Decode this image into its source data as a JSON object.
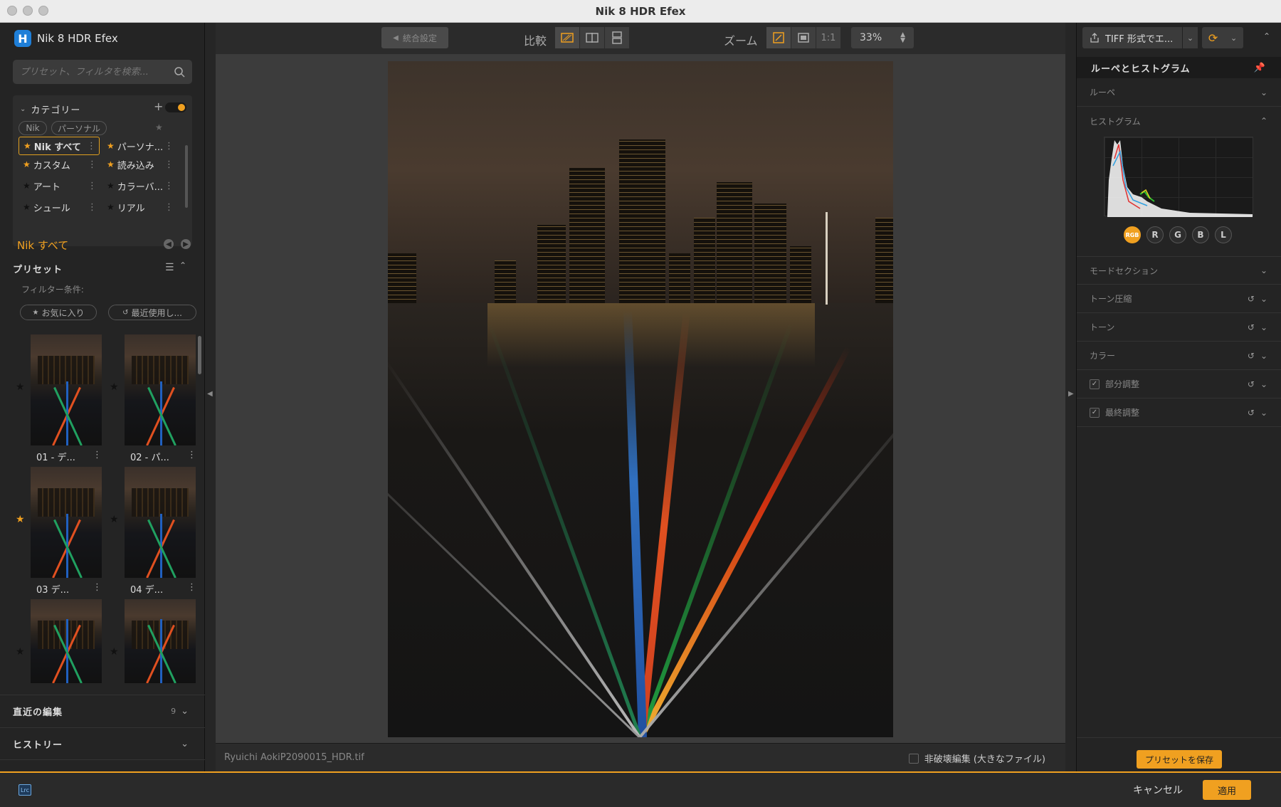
{
  "window": {
    "title": "Nik 8 HDR Efex"
  },
  "brand": {
    "name": "Nik 8 HDR Efex",
    "logo": "H"
  },
  "search": {
    "placeholder": "プリセット、フィルタを検索..."
  },
  "categories": {
    "title": "カテゴリー",
    "pills": [
      "Nik",
      "パーソナル"
    ],
    "items": [
      {
        "label": "Nik すべて",
        "starred": true,
        "selected": true
      },
      {
        "label": "パーソナ...",
        "starred": true,
        "selected": false
      },
      {
        "label": "カスタム",
        "starred": true,
        "selected": false
      },
      {
        "label": "読み込み",
        "starred": true,
        "selected": false
      },
      {
        "label": "アート",
        "starred": false,
        "selected": false
      },
      {
        "label": "カラーバ...",
        "starred": false,
        "selected": false
      },
      {
        "label": "シュール",
        "starred": false,
        "selected": false
      },
      {
        "label": "リアル",
        "starred": false,
        "selected": false
      }
    ]
  },
  "current_category": "Nik すべて",
  "presets": {
    "title": "プリセット",
    "filter_label": "フィルター条件:",
    "filters": [
      "お気に入り",
      "最近使用し..."
    ],
    "thumbs": [
      {
        "label": "01 - デ...",
        "starred": false
      },
      {
        "label": "02 - パ...",
        "starred": false
      },
      {
        "label": "03 デ...",
        "starred": true
      },
      {
        "label": "04 デ...",
        "starred": false
      },
      {
        "label": "",
        "starred": false
      },
      {
        "label": "",
        "starred": false
      }
    ]
  },
  "recent_edits": {
    "title": "直近の編集",
    "count": "9"
  },
  "history": {
    "title": "ヒストリー"
  },
  "toolbar": {
    "merge_settings": "統合設定",
    "compare_label": "比較",
    "zoom_label": "ズーム",
    "one_to_one": "1:1",
    "zoom_value": "33%"
  },
  "status": {
    "filename": "Ryuichi AokiP2090015_HDR.tif",
    "nondestructive": "非破壊編集 (大きなファイル)"
  },
  "right": {
    "export_label": "TIFF 形式でエ...",
    "loupe_histogram": "ルーペとヒストグラム",
    "loupe": "ルーペ",
    "histogram": "ヒストグラム",
    "channels": [
      "RGB",
      "R",
      "G",
      "B",
      "L"
    ],
    "sections": [
      {
        "label": "モードセクション",
        "reset": false,
        "checkbox": false
      },
      {
        "label": "トーン圧縮",
        "reset": true,
        "checkbox": false
      },
      {
        "label": "トーン",
        "reset": true,
        "checkbox": false
      },
      {
        "label": "カラー",
        "reset": true,
        "checkbox": false
      },
      {
        "label": "部分調整",
        "reset": true,
        "checkbox": true
      },
      {
        "label": "最終調整",
        "reset": true,
        "checkbox": true
      }
    ],
    "save_preset": "プリセットを保存"
  },
  "footer": {
    "lrc": "Lrc",
    "cancel": "キャンセル",
    "apply": "適用"
  },
  "colors": {
    "accent": "#f0a020",
    "background": "#262626",
    "panel": "#242424"
  }
}
